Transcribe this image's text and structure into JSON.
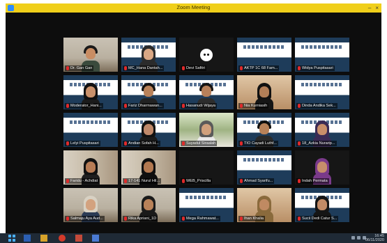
{
  "window": {
    "title": "Zoom Meeting",
    "controls": {
      "minimize": "–",
      "close": "×"
    },
    "titlebar_color": "#f0cf1a"
  },
  "participants": [
    {
      "name": "Dr. Gan Gan",
      "bg": "bg-room",
      "person": {
        "skin": "#c98d63",
        "hair": "#1a1a1a",
        "hijab": false,
        "top": "#3a4a3c"
      }
    },
    {
      "name": "MC_Hana Dantah...",
      "bg": "bg-banner",
      "person": {
        "skin": "#d9a784",
        "hair": "#2b2b2b",
        "hijab": true,
        "top": "#2b2b2b"
      }
    },
    {
      "name": "Devi Safitri",
      "bg": "bg-dark",
      "avatar": true,
      "active": true
    },
    {
      "name": "AKTP 1C 68 Fam...",
      "bg": "bg-banner"
    },
    {
      "name": "Widya Puspitasari",
      "bg": "bg-banner"
    },
    {
      "name": "Moderator_Hani...",
      "bg": "bg-banner",
      "person": {
        "skin": "#c9916b",
        "hair": "#101010",
        "hijab": true,
        "top": "#1b1b1b"
      }
    },
    {
      "name": "Fariz Dharmawan...",
      "bg": "bg-banner",
      "person": {
        "skin": "#b9825a",
        "hair": "#111111",
        "hijab": false,
        "top": "#222222"
      }
    },
    {
      "name": "Hasanudi Wijaya",
      "bg": "bg-banner",
      "person": {
        "skin": "#b7805a",
        "hair": "#141414",
        "hijab": false,
        "top": "#2d2d2d"
      }
    },
    {
      "name": "Nia Kurniasih",
      "bg": "bg-warm",
      "person": {
        "skin": "#b27e57",
        "hair": "#111111",
        "hijab": true,
        "top": "#151515"
      }
    },
    {
      "name": "Dinda Andika Sek...",
      "bg": "bg-banner"
    },
    {
      "name": "Lelyi Puspitasari",
      "bg": "bg-banner"
    },
    {
      "name": "Andian Sofah H...",
      "bg": "bg-banner",
      "person": {
        "skin": "#c0896a",
        "hair": "#111111",
        "hijab": true,
        "top": "#1a1a1a"
      }
    },
    {
      "name": "Suyadul Siraalah",
      "bg": "bg-green",
      "person": {
        "skin": "#d0a07c",
        "hair": "#5a5a5a",
        "hijab": true,
        "top": "#e8e8e8"
      }
    },
    {
      "name": "TIO Cayadi Luthf...",
      "bg": "bg-banner",
      "person": {
        "skin": "#b88259",
        "hair": "#101010",
        "hijab": false,
        "top": "#2a2a2a"
      }
    },
    {
      "name": "18_Azkia Nurarip...",
      "bg": "bg-banner",
      "person": {
        "skin": "#c98f6a",
        "hair": "#3b2b55",
        "hijab": true,
        "top": "#3b2b55"
      }
    },
    {
      "name": "Faridu - Achdiat",
      "bg": "bg-door",
      "person": {
        "skin": "#b77c55",
        "hair": "#111111",
        "hijab": true,
        "top": "#1e1e1e"
      }
    },
    {
      "name": "17-141 Nurul Hil...",
      "bg": "bg-door",
      "person": {
        "skin": "#b27850",
        "hair": "#0f0f0f",
        "hijab": true,
        "top": "#0f0f0f"
      }
    },
    {
      "name": "WEB_Priscilla",
      "bg": "bg-dark"
    },
    {
      "name": "Ahmad Syarifu...",
      "bg": "bg-banner"
    },
    {
      "name": "Indah Permata",
      "bg": "bg-dark",
      "person": {
        "skin": "#c78e6b",
        "hair": "#7a3a8a",
        "hijab": true,
        "top": "#7a3a8a"
      }
    },
    {
      "name": "Salmaju Aya Aud...",
      "bg": "bg-room",
      "person": {
        "skin": "#d3a27f",
        "hair": "#d8d1c3",
        "hijab": true,
        "top": "#2b3b55"
      }
    },
    {
      "name": "Rika Apriani_1D",
      "bg": "bg-room",
      "person": {
        "skin": "#b98259",
        "hair": "#1a1a1a",
        "hijab": true,
        "top": "#1a1a1a"
      }
    },
    {
      "name": "Mega Rahmawat...",
      "bg": "bg-banner"
    },
    {
      "name": "Ihan Khalia",
      "bg": "bg-warm",
      "person": {
        "skin": "#c08a62",
        "hair": "#8a6a3c",
        "hijab": true,
        "top": "#8a6a3c"
      }
    },
    {
      "name": "Sucii Dedi Catur S...",
      "bg": "bg-banner",
      "person": {
        "skin": "#c28b66",
        "hair": "#151515",
        "hijab": true,
        "top": "#151515"
      }
    }
  ],
  "taskbar": {
    "time": "16:45",
    "date": "06/11/2020"
  }
}
